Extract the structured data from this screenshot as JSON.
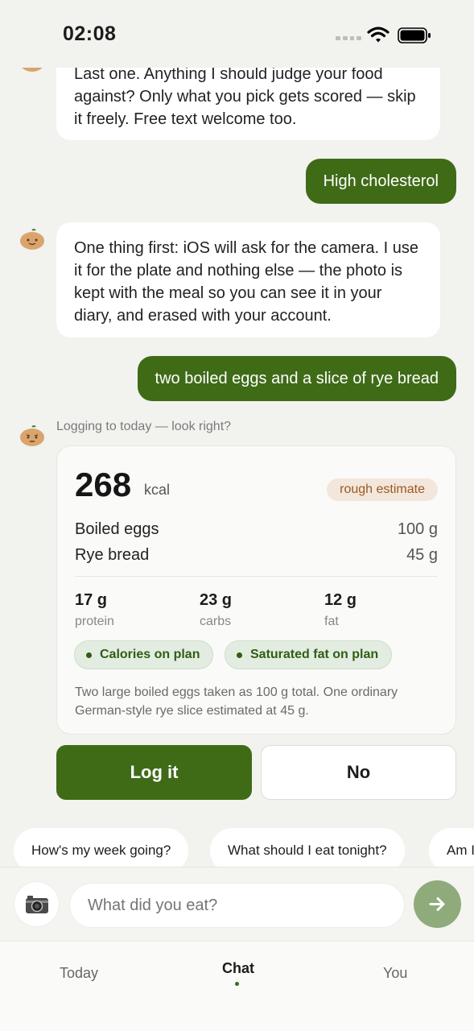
{
  "status_bar": {
    "time": "02:08"
  },
  "messages": {
    "bot_1": "Last one. Anything I should judge your food against? Only what you pick gets scored — skip it freely. Free text welcome too.",
    "user_1": "High cholesterol",
    "bot_2": "One thing first: iOS will ask for the camera. I use it for the plate and nothing else — the photo is kept with the meal so you can see it in your diary, and erased with your account.",
    "user_2": "two boiled eggs and a slice of rye bread"
  },
  "log_card": {
    "label": "Logging to today — look right?",
    "calories": "268",
    "calories_unit": "kcal",
    "estimate_badge": "rough estimate",
    "items": [
      {
        "name": "Boiled eggs",
        "qty": "100 g"
      },
      {
        "name": "Rye bread",
        "qty": "45 g"
      }
    ],
    "macros": [
      {
        "value": "17 g",
        "label": "protein"
      },
      {
        "value": "23 g",
        "label": "carbs"
      },
      {
        "value": "12 g",
        "label": "fat"
      }
    ],
    "checks": [
      "Calories on plan",
      "Saturated fat on plan"
    ],
    "note": "Two large boiled eggs taken as 100 g total. One ordinary German-style rye slice estimated at 45 g."
  },
  "actions": {
    "confirm": "Log it",
    "reject": "No"
  },
  "suggestions": [
    "How's my week going?",
    "What should I eat tonight?",
    "Am I"
  ],
  "composer": {
    "placeholder": "What did you eat?"
  },
  "tabs": [
    {
      "label": "Today"
    },
    {
      "label": "Chat"
    },
    {
      "label": "You"
    }
  ],
  "colors": {
    "accent": "#3f6b17",
    "background": "#f2f2ef",
    "send_button": "#8fab7c",
    "badge": "#f3e6dc"
  },
  "icons": {
    "camera": "camera-icon",
    "send": "arrow-right-icon",
    "avatar": "onion-mascot-icon"
  }
}
